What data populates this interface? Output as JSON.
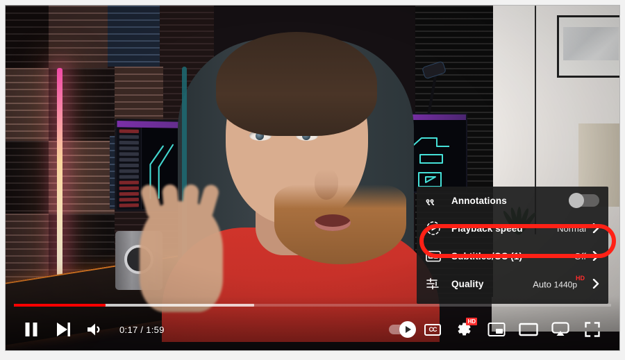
{
  "player": {
    "time_display": "0:17 / 1:59",
    "current_time": "0:17",
    "duration": "1:59",
    "progress_percent": 15.3,
    "buffered_percent": 40.2,
    "accent_color": "#ff0000",
    "highlight_color": "#ff2116"
  },
  "settings_menu": {
    "rows": [
      {
        "icon": "annotations-icon",
        "label": "Annotations",
        "control": "toggle",
        "value": "Off",
        "toggle_on": false
      },
      {
        "icon": "playback-speed-icon",
        "label": "Playback speed",
        "control": "chevron",
        "value": "Normal",
        "highlighted": true
      },
      {
        "icon": "subtitles-cc-icon",
        "label": "Subtitles/CC (1)",
        "control": "chevron",
        "value": "Off"
      },
      {
        "icon": "quality-icon",
        "label": "Quality",
        "control": "chevron",
        "value_auto": "Auto",
        "value_res": "1440p",
        "value_badge": "HD"
      }
    ]
  },
  "controls": {
    "left": [
      {
        "name": "pause-button",
        "label": "Pause"
      },
      {
        "name": "next-video-button",
        "label": "Next"
      },
      {
        "name": "volume-button",
        "label": "Mute"
      }
    ],
    "right": [
      {
        "name": "autoplay-toggle",
        "label": "Autoplay is on"
      },
      {
        "name": "subtitles-button",
        "label": "Subtitles/closed captions (c)",
        "glyph": "CC"
      },
      {
        "name": "settings-button",
        "label": "Settings",
        "badge": "HD"
      },
      {
        "name": "miniplayer-button",
        "label": "Miniplayer (i)"
      },
      {
        "name": "theater-button",
        "label": "Theater mode (t)"
      },
      {
        "name": "cast-button",
        "label": "Play on TV"
      },
      {
        "name": "fullscreen-button",
        "label": "Full screen (f)"
      }
    ]
  },
  "scene": {
    "description": "Person in red shirt speaking to camera in a studio room with acoustic foam panels, an RGB light bar, dual monitors and a framed picture on a white wall."
  }
}
